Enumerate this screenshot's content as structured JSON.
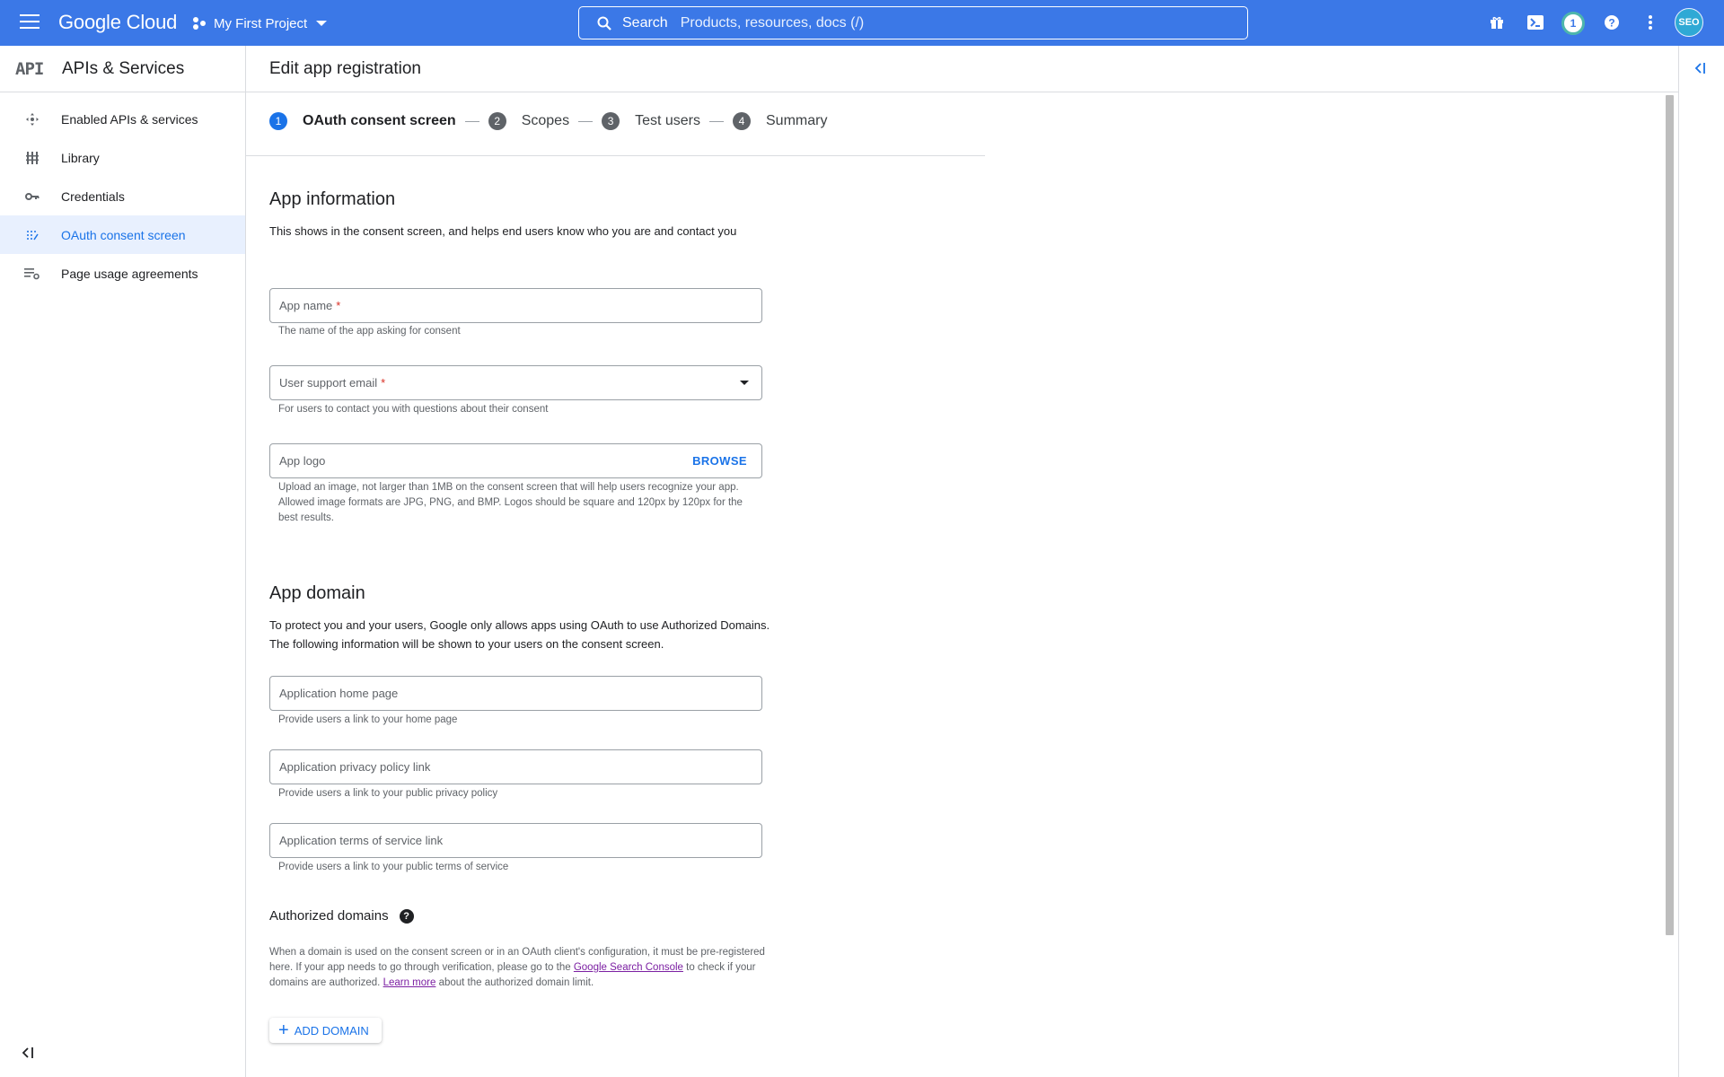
{
  "topbar": {
    "logo": "Google Cloud",
    "project": "My First Project",
    "search_label": "Search",
    "search_placeholder": "Products, resources, docs (/)",
    "notification_count": "1",
    "avatar_text": "SEO"
  },
  "sidebar": {
    "product_logo": "API",
    "title": "APIs & Services",
    "items": [
      {
        "label": "Enabled APIs & services",
        "icon": "endpoints-icon"
      },
      {
        "label": "Library",
        "icon": "library-icon"
      },
      {
        "label": "Credentials",
        "icon": "key-icon"
      },
      {
        "label": "OAuth consent screen",
        "icon": "consent-icon",
        "active": true
      },
      {
        "label": "Page usage agreements",
        "icon": "settings-list-icon"
      }
    ]
  },
  "main": {
    "title": "Edit app registration",
    "steps": [
      {
        "num": "1",
        "label": "OAuth consent screen",
        "active": true
      },
      {
        "num": "2",
        "label": "Scopes"
      },
      {
        "num": "3",
        "label": "Test users"
      },
      {
        "num": "4",
        "label": "Summary"
      }
    ],
    "app_info": {
      "heading": "App information",
      "description": "This shows in the consent screen, and helps end users know who you are and contact you",
      "app_name_label": "App name",
      "app_name_hint": "The name of the app asking for consent",
      "support_email_label": "User support email",
      "support_email_hint": "For users to contact you with questions about their consent",
      "logo_label": "App logo",
      "browse": "BROWSE",
      "logo_hint": "Upload an image, not larger than 1MB on the consent screen that will help users recognize your app. Allowed image formats are JPG, PNG, and BMP. Logos should be square and 120px by 120px for the best results."
    },
    "app_domain": {
      "heading": "App domain",
      "description": "To protect you and your users, Google only allows apps using OAuth to use Authorized Domains. The following information will be shown to your users on the consent screen.",
      "home_page_label": "Application home page",
      "home_page_hint": "Provide users a link to your home page",
      "privacy_label": "Application privacy policy link",
      "privacy_hint": "Provide users a link to your public privacy policy",
      "tos_label": "Application terms of service link",
      "tos_hint": "Provide users a link to your public terms of service"
    },
    "authorized_domains": {
      "heading": "Authorized domains",
      "text_1": "When a domain is used on the consent screen or in an OAuth client's configuration, it must be pre-registered here. If your app needs to go through verification, please go to the ",
      "link_search_console": "Google Search Console",
      "text_2": " to check if your domains are authorized. ",
      "link_learn_more": "Learn more",
      "text_3": " about the authorized domain limit.",
      "add_button": "ADD DOMAIN"
    }
  },
  "colors": {
    "topbar": "#3b78e7",
    "accent": "#1a73e8",
    "active_nav_bg": "#e8f0fe",
    "required": "#d93025"
  }
}
